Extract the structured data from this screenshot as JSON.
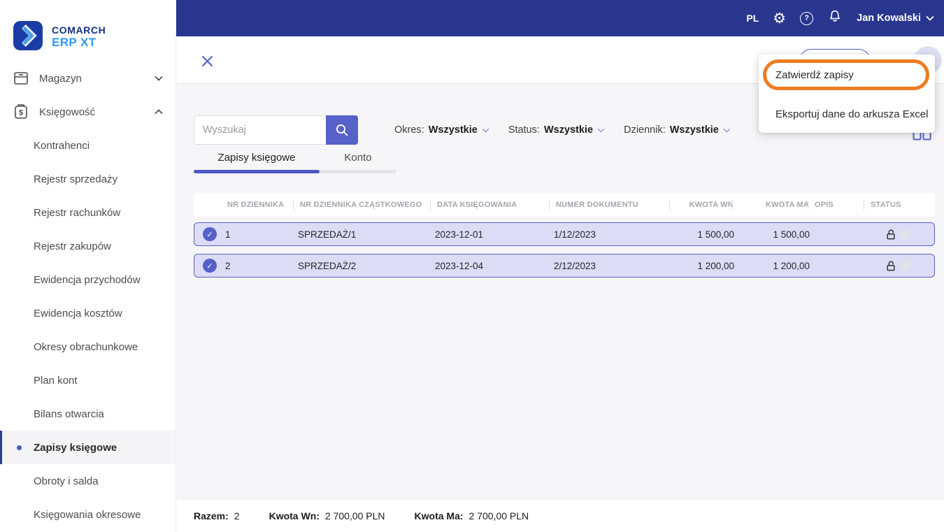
{
  "brand": {
    "line1": "COMARCH",
    "line2": "ERP XT"
  },
  "topbar": {
    "language": "PL",
    "user": "Jan Kowalski"
  },
  "sidebar": {
    "magazyn": "Magazyn",
    "ksiegowosc": "Księgowość",
    "items": [
      "Kontrahenci",
      "Rejestr sprzedaży",
      "Rejestr rachunków",
      "Rejestr zakupów",
      "Ewidencja przychodów",
      "Ewidencja kosztów",
      "Okresy obrachunkowe",
      "Plan kont",
      "Bilans otwarcia",
      "Zapisy księgowe",
      "Obroty i salda",
      "Księgowania okresowe"
    ],
    "active_item": "Zapisy księgowe"
  },
  "menu": {
    "items": [
      "Zatwierdź zapisy",
      "Eksportuj dane do arkusza Excel"
    ],
    "highlighted": "Zatwierdź zapisy"
  },
  "search": {
    "placeholder": "Wyszukaj"
  },
  "filters": [
    {
      "label": "Okres:",
      "value": "Wszystkie"
    },
    {
      "label": "Status:",
      "value": "Wszystkie"
    },
    {
      "label": "Dziennik:",
      "value": "Wszystkie"
    }
  ],
  "tabs": [
    {
      "label": "Zapisy księgowe",
      "active": true
    },
    {
      "label": "Konto",
      "active": false
    }
  ],
  "table": {
    "columns": [
      "NR DZIENNIKA",
      "NR DZIENNIKA CZĄSTKOWEGO",
      "DATA KSIĘGOWANIA",
      "NUMER DOKUMENTU",
      "KWOTA WN",
      "KWOTA MA",
      "OPIS",
      "STATUS"
    ],
    "rows": [
      {
        "nr": "1",
        "journal": "SPRZEDAŻ/1",
        "date": "2023-12-01",
        "document": "1/12/2023",
        "wn": "1 500,00",
        "ma": "1 500,00",
        "opis": "",
        "selected": true,
        "locked": false
      },
      {
        "nr": "2",
        "journal": "SPRZEDAŻ/2",
        "date": "2023-12-04",
        "document": "2/12/2023",
        "wn": "1 200,00",
        "ma": "1 200,00",
        "opis": "",
        "selected": true,
        "locked": false
      }
    ]
  },
  "summary": {
    "razem_label": "Razem:",
    "razem": "2",
    "wn_label": "Kwota Wn:",
    "wn": "2 700,00 PLN",
    "ma_label": "Kwota Ma:",
    "ma": "2 700,00 PLN"
  },
  "colors": {
    "navbar": "#29368e",
    "accent": "#5661c9",
    "highlight": "#ee7c22",
    "row_bg": "#dcdcf6",
    "row_border": "#5a5fc8"
  }
}
